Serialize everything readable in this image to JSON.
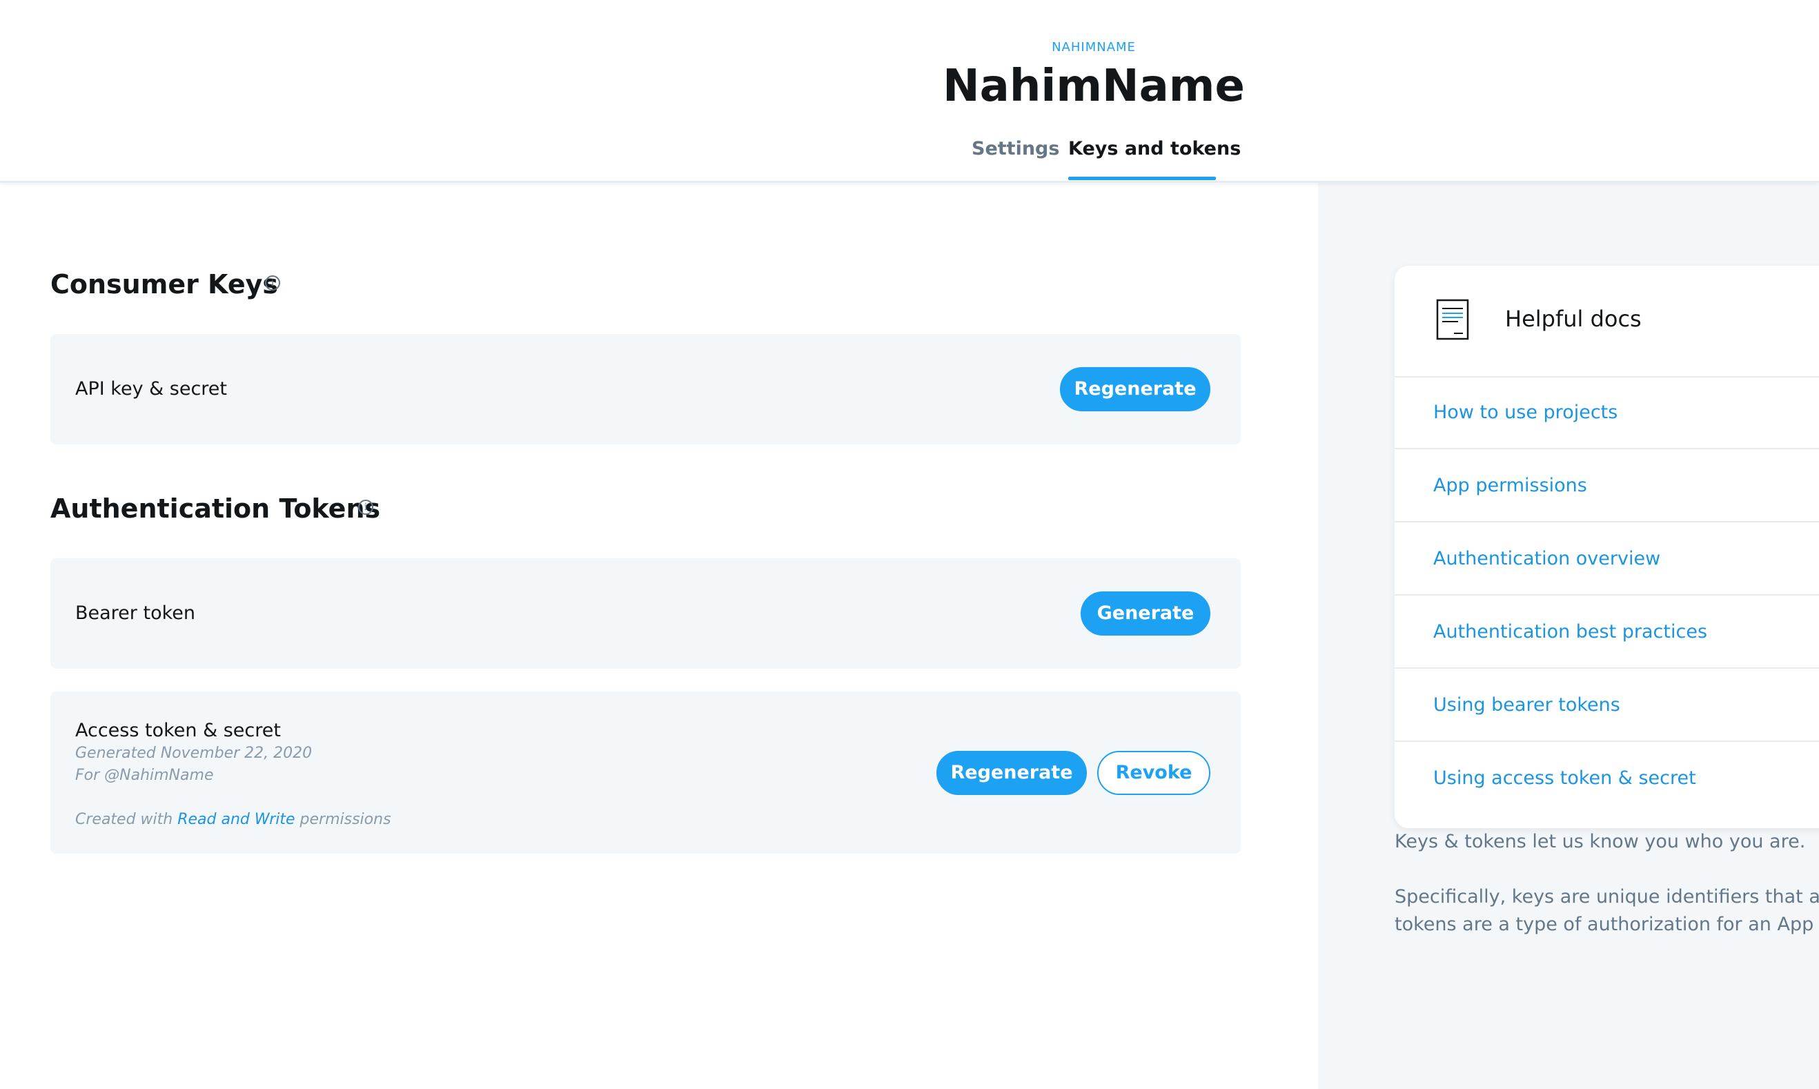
{
  "header": {
    "eyebrow": "NAHIMNAME",
    "app_title": "NahimName",
    "tabs": [
      {
        "label": "Settings",
        "active": false
      },
      {
        "label": "Keys and tokens",
        "active": true
      }
    ]
  },
  "consumer_keys": {
    "title": "Consumer Keys",
    "info_icon": "info-icon",
    "api_key": {
      "label": "API key & secret",
      "button": "Regenerate"
    }
  },
  "auth_tokens": {
    "title": "Authentication Tokens",
    "info_icon": "info-icon",
    "bearer": {
      "label": "Bearer token",
      "button": "Generate"
    },
    "access": {
      "label": "Access token & secret",
      "generated": "Generated November 22, 2020",
      "for_user": "For @NahimName",
      "created_prefix": "Created with",
      "permission_link": "Read and Write",
      "created_suffix": "permissions",
      "regenerate_button": "Regenerate",
      "revoke_button": "Revoke"
    }
  },
  "sidebar": {
    "docs_icon": "document-icon",
    "docs_title": "Helpful docs",
    "links": [
      "How to use projects",
      "App permissions",
      "Authentication overview",
      "Authentication best practices",
      "Using bearer tokens",
      "Using access token & secret"
    ],
    "blurb_1": "Keys & tokens let us know you who you are.",
    "blurb_2_line_1": "Specifically, keys are unique identifiers that authen",
    "blurb_2_line_2": "tokens are a type of authorization for an App to g"
  },
  "colors": {
    "accent": "#1da1f2",
    "link": "#1b95e0",
    "text": "#14171a",
    "muted": "#657786",
    "panel": "#f4f7fa"
  }
}
